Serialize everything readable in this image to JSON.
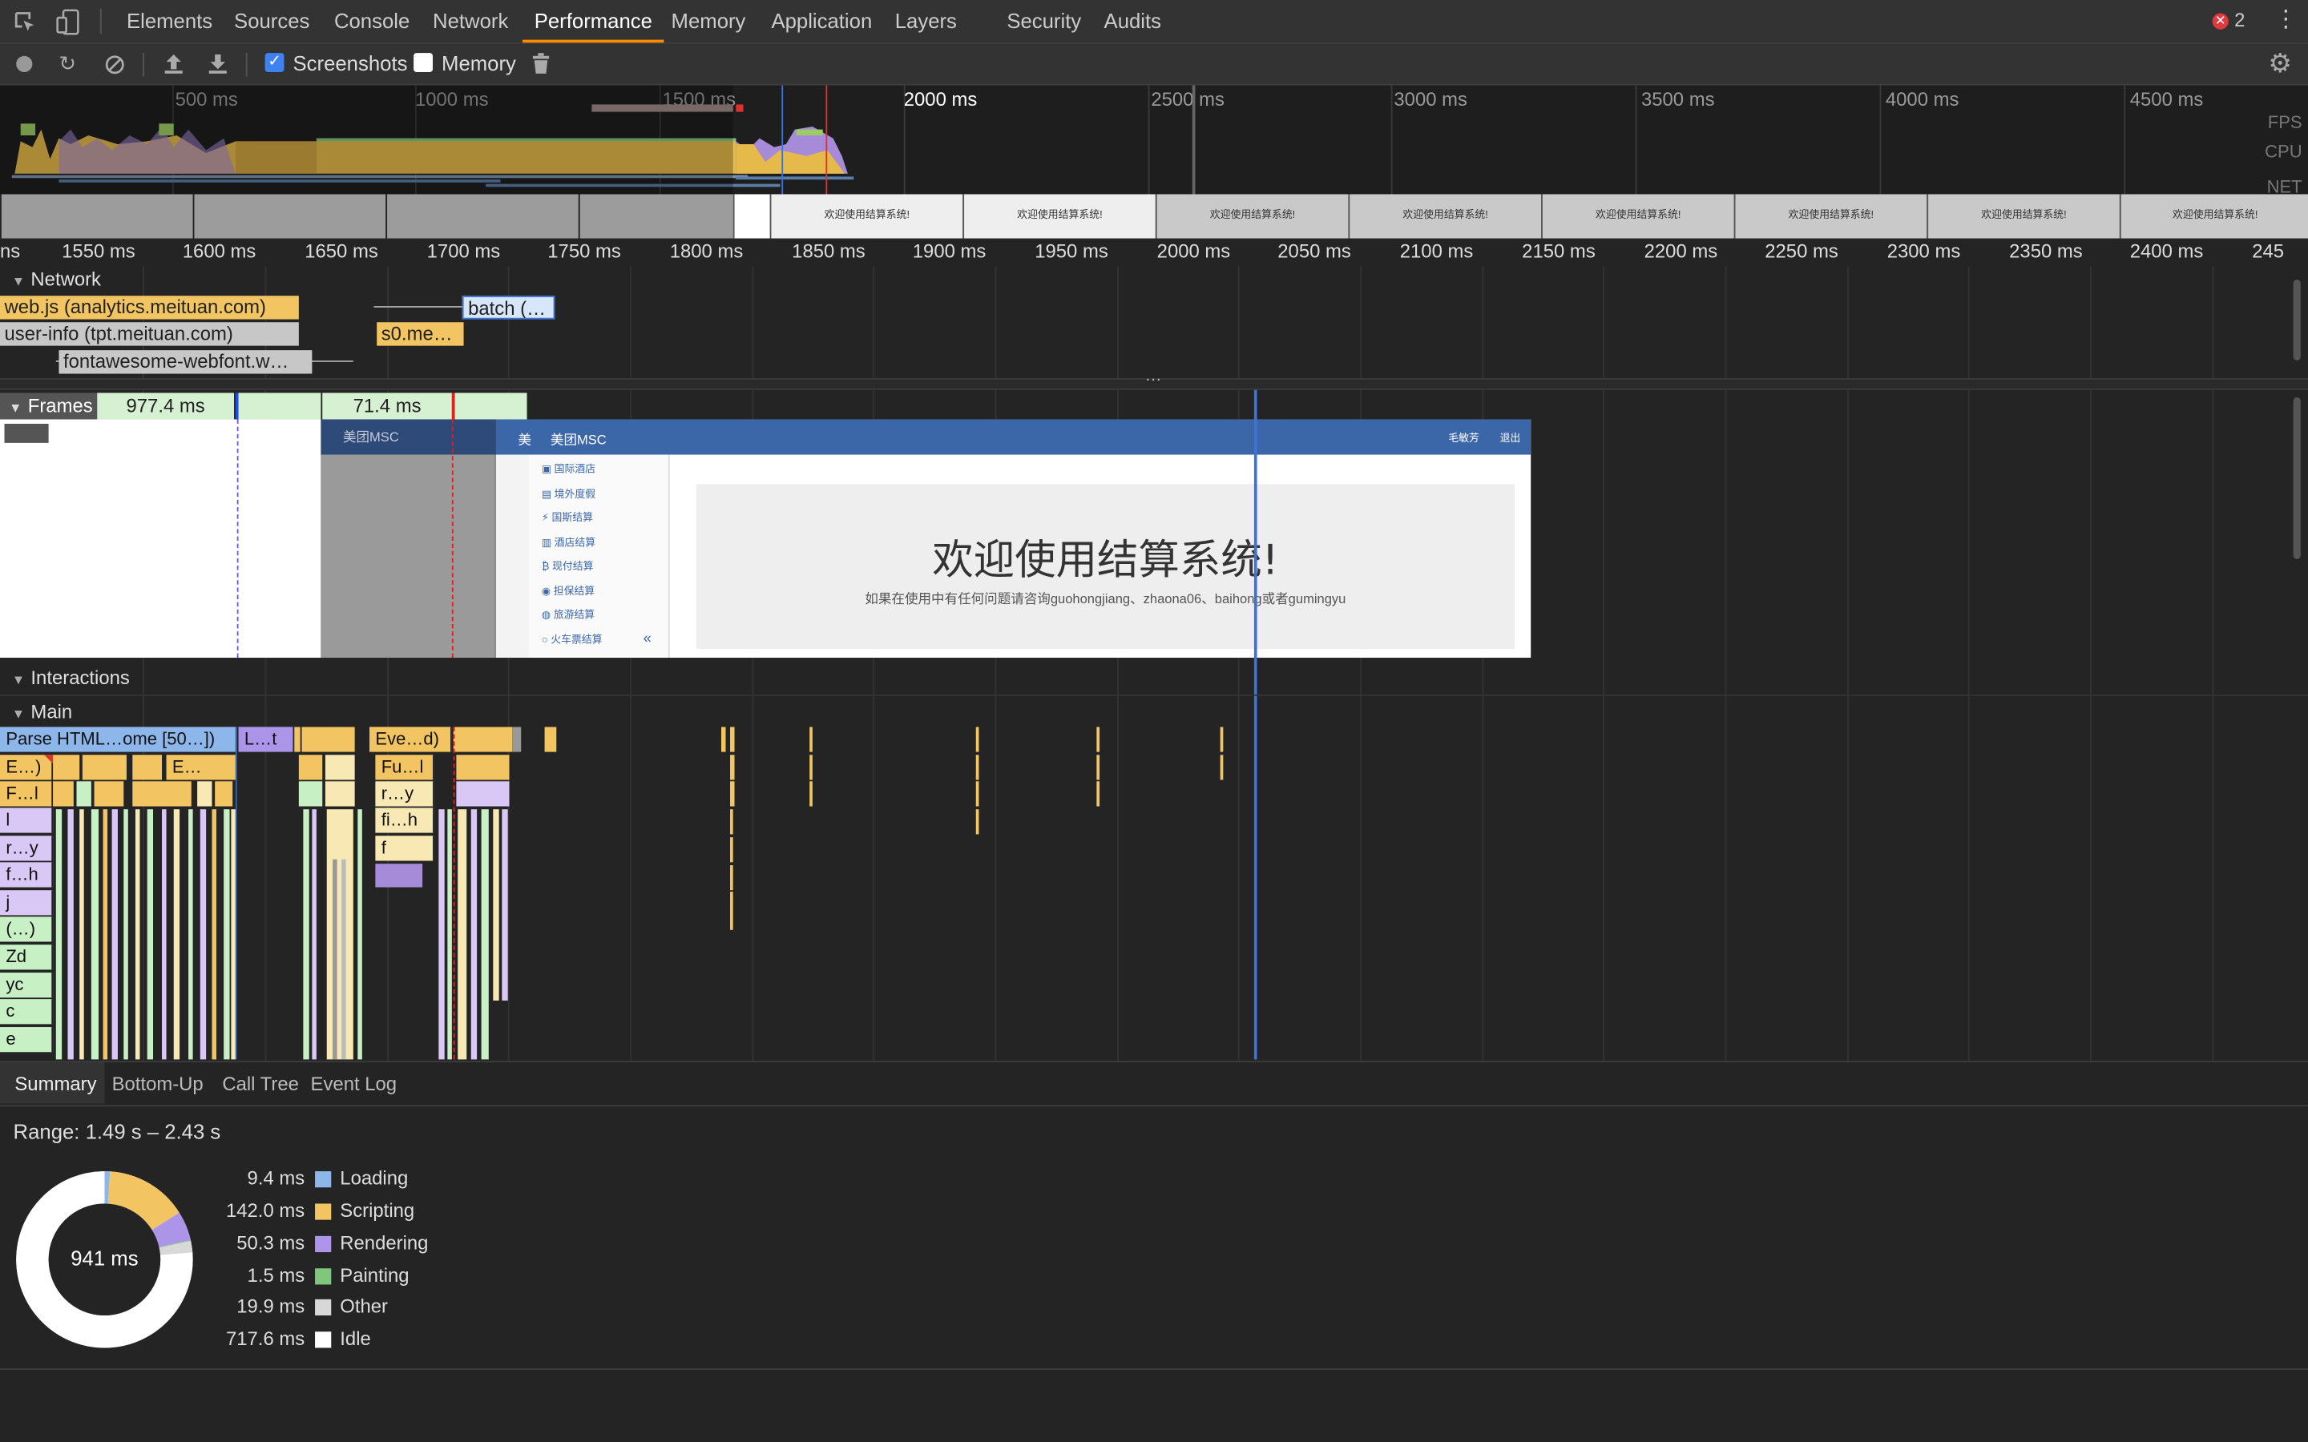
{
  "tabs": [
    "Elements",
    "Sources",
    "Console",
    "Network",
    "Performance",
    "Memory",
    "Application",
    "Layers",
    "Security",
    "Audits"
  ],
  "active_tab": "Performance",
  "error_count": "2",
  "toolbar": {
    "screenshots_label": "Screenshots",
    "memory_label": "Memory",
    "screenshots_checked": true,
    "memory_checked": false
  },
  "overview": {
    "ticks": [
      "500 ms",
      "1000 ms",
      "1500 ms",
      "2000 ms",
      "2500 ms",
      "3000 ms",
      "3500 ms",
      "4000 ms",
      "4500 ms"
    ],
    "side_labels": [
      "FPS",
      "CPU",
      "NET"
    ],
    "thumb_text": "欢迎使用结算系统!"
  },
  "ruler": [
    "ns",
    "1550 ms",
    "1600 ms",
    "1650 ms",
    "1700 ms",
    "1750 ms",
    "1800 ms",
    "1850 ms",
    "1900 ms",
    "1950 ms",
    "2000 ms",
    "2050 ms",
    "2100 ms",
    "2150 ms",
    "2200 ms",
    "2250 ms",
    "2300 ms",
    "2350 ms",
    "2400 ms",
    "245"
  ],
  "network": {
    "title": "Network",
    "requests": [
      "web.js (analytics.meituan.com)",
      "user-info (tpt.meituan.com)",
      "fontawesome-webfont.w…",
      "batch (…",
      "s0.me…"
    ]
  },
  "frames": {
    "title": "Frames",
    "durations": [
      "977.4 ms",
      "71.4 ms"
    ]
  },
  "screenshot": {
    "brand": "美团MSC",
    "brand_short": "美",
    "user": "毛敏芳",
    "logout": "退出",
    "menu": [
      "国际酒店",
      "境外度假",
      "国斯结算",
      "酒店结算",
      "现付结算",
      "担保结算",
      "旅游结算",
      "火车票结算"
    ],
    "heading": "欢迎使用结算系统!",
    "subtext": "如果在使用中有任何问题请咨询guohongjiang、zhaona06、baihong或者gumingyu",
    "collapse": "«"
  },
  "interactions_title": "Interactions",
  "main": {
    "title": "Main",
    "top_blocks": [
      "Parse HTML…ome [50…])",
      "L…t",
      "Eve…d)"
    ],
    "left_stack": [
      "E…)",
      "F…l",
      "l",
      "r…y",
      "f…h",
      "j",
      "(…)",
      "Zd",
      "yc",
      "c",
      "e"
    ],
    "left_stack2": [
      "E…"
    ],
    "mid_stack": [
      "Fu…l",
      "r…y",
      "fi…h",
      "f"
    ]
  },
  "summary": {
    "tabs": [
      "Summary",
      "Bottom-Up",
      "Call Tree",
      "Event Log"
    ],
    "range": "Range: 1.49 s – 2.43 s",
    "total": "941 ms",
    "items": [
      {
        "value": "9.4 ms",
        "label": "Loading",
        "color": "#8db7ea"
      },
      {
        "value": "142.0 ms",
        "label": "Scripting",
        "color": "#f2c462"
      },
      {
        "value": "50.3 ms",
        "label": "Rendering",
        "color": "#ac95e8"
      },
      {
        "value": "1.5 ms",
        "label": "Painting",
        "color": "#7fc77c"
      },
      {
        "value": "19.9 ms",
        "label": "Other",
        "color": "#d8d8d8"
      },
      {
        "value": "717.6 ms",
        "label": "Idle",
        "color": "#ffffff"
      }
    ]
  }
}
